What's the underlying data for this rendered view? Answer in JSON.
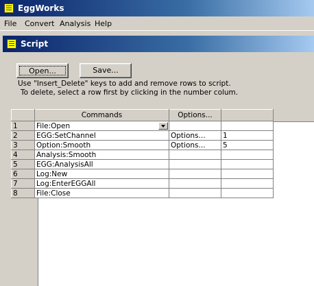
{
  "app": {
    "title": "EggWorks"
  },
  "menu": [
    "File",
    "Convert",
    "Analysis",
    "Help"
  ],
  "window": {
    "title": "Script"
  },
  "buttons": {
    "open": "Open...",
    "save": "Save..."
  },
  "hints": [
    "Use \"Insert_Delete\" keys to add and remove rows to script.",
    "To delete, select a row first by clicking in the number colum."
  ],
  "grid": {
    "headers": [
      "",
      "Commands",
      "Options...",
      ""
    ],
    "rows": [
      {
        "num": "1",
        "command": "File:Open",
        "options": "",
        "value": ""
      },
      {
        "num": "2",
        "command": "EGG:SetChannel",
        "options": "Options...",
        "value": "1"
      },
      {
        "num": "3",
        "command": "Option:Smooth",
        "options": "Options...",
        "value": "5"
      },
      {
        "num": "4",
        "command": "Analysis:Smooth",
        "options": "",
        "value": ""
      },
      {
        "num": "5",
        "command": "EGG:AnalysisAll",
        "options": "",
        "value": ""
      },
      {
        "num": "6",
        "command": "Log:New",
        "options": "",
        "value": ""
      },
      {
        "num": "7",
        "command": "Log:EnterEGGAll",
        "options": "",
        "value": ""
      },
      {
        "num": "8",
        "command": "File:Close",
        "options": "",
        "value": ""
      }
    ]
  }
}
